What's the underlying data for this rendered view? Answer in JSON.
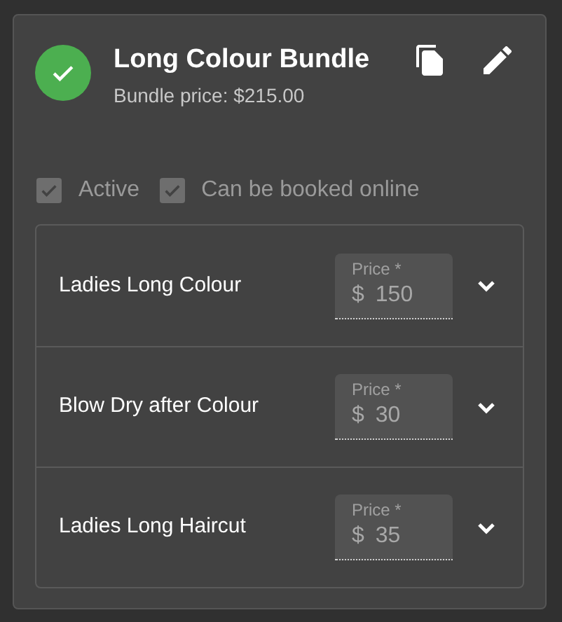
{
  "bundle": {
    "title": "Long Colour Bundle",
    "subtitle": "Bundle price: $215.00",
    "status_ok": true
  },
  "options": [
    {
      "label": "Active",
      "checked": true,
      "disabled": true
    },
    {
      "label": "Can be booked online",
      "checked": true,
      "disabled": true
    }
  ],
  "services": [
    {
      "name": "Ladies Long Colour",
      "price_label": "Price *",
      "currency": "$",
      "price": "150",
      "disabled": true,
      "expanded": false
    },
    {
      "name": "Blow Dry after Colour",
      "price_label": "Price *",
      "currency": "$",
      "price": "30",
      "disabled": true,
      "expanded": false
    },
    {
      "name": "Ladies Long Haircut",
      "price_label": "Price *",
      "currency": "$",
      "price": "35",
      "disabled": true,
      "expanded": false
    }
  ]
}
